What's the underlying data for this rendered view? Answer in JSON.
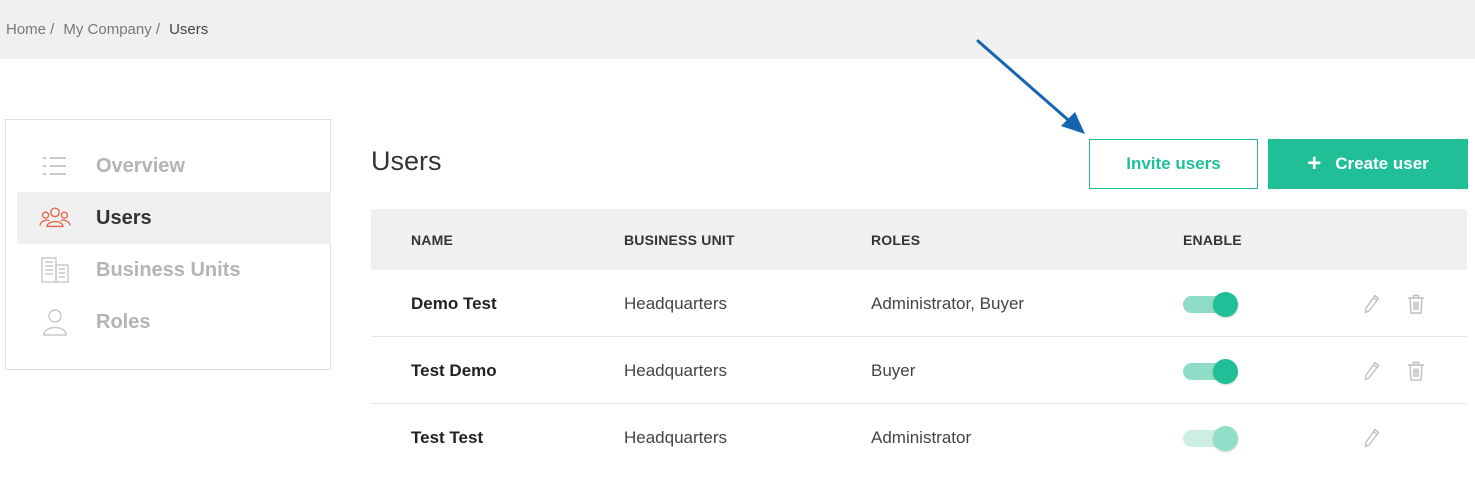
{
  "breadcrumb": {
    "items": [
      {
        "label": "Home /"
      },
      {
        "label": "My Company /"
      },
      {
        "label": "Users"
      }
    ]
  },
  "sidebar": {
    "items": [
      {
        "label": "Overview",
        "icon": "list-icon",
        "active": false
      },
      {
        "label": "Users",
        "icon": "users-icon",
        "active": true
      },
      {
        "label": "Business Units",
        "icon": "building-icon",
        "active": false
      },
      {
        "label": "Roles",
        "icon": "person-icon",
        "active": false
      }
    ]
  },
  "main": {
    "title": "Users",
    "invite_label": "Invite users",
    "create_label": "Create user",
    "create_icon": "+"
  },
  "table": {
    "headers": {
      "name": "NAME",
      "business_unit": "BUSINESS UNIT",
      "roles": "ROLES",
      "enable": "ENABLE"
    },
    "rows": [
      {
        "name": "Demo Test",
        "business_unit": "Headquarters",
        "roles": "Administrator, Buyer",
        "enabled": true,
        "toggle_disabled": false,
        "deletable": true
      },
      {
        "name": "Test Demo",
        "business_unit": "Headquarters",
        "roles": "Buyer",
        "enabled": true,
        "toggle_disabled": false,
        "deletable": true
      },
      {
        "name": "Test Test",
        "business_unit": "Headquarters",
        "roles": "Administrator",
        "enabled": true,
        "toggle_disabled": true,
        "deletable": false
      }
    ]
  },
  "colors": {
    "accent": "#20bf98",
    "annotation_arrow": "#1565b0",
    "active_icon": "#e8614a"
  }
}
